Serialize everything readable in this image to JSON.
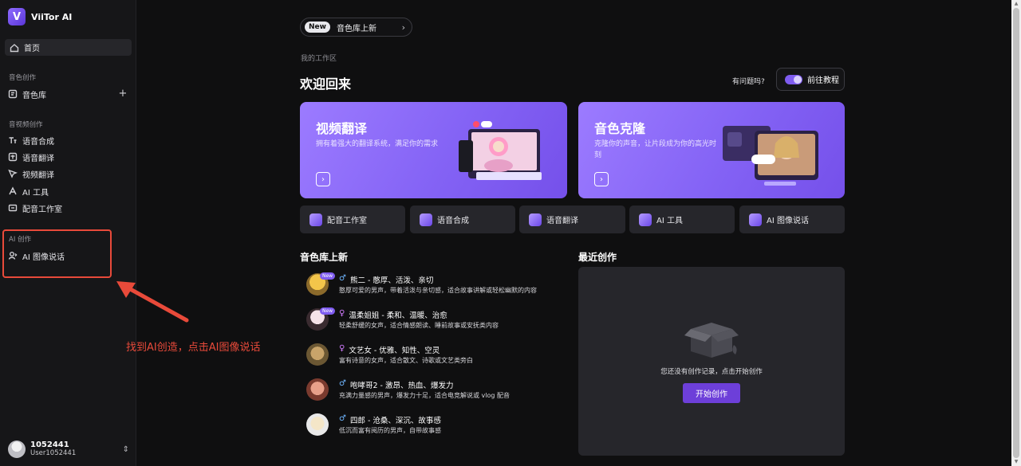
{
  "brand": {
    "logo_letter": "V",
    "name": "ViiTor AI"
  },
  "sidebar": {
    "home_label": "首页",
    "section_voice": "音色创作",
    "voice_library": "音色库",
    "section_av": "音视频创作",
    "av_items": [
      "语音合成",
      "语音翻译",
      "视频翻译",
      "AI 工具",
      "配音工作室"
    ],
    "section_ai": "AI 创作",
    "ai_image_talk": "AI 图像说话"
  },
  "user": {
    "name": "1052441",
    "handle": "User1052441"
  },
  "annotation": {
    "text": "找到AI创造，点击AI图像说话",
    "color": "#e84a3a"
  },
  "badge": {
    "tag": "New",
    "text": "音色库上新"
  },
  "main": {
    "workspace_label": "我的工作区",
    "welcome": "欢迎回来",
    "help_text": "有问题吗?",
    "tutorial_label": "前往教程"
  },
  "heroes": [
    {
      "title": "视频翻译",
      "desc": "拥有着强大的翻译系统，满足你的需求"
    },
    {
      "title": "音色克隆",
      "desc": "克隆你的声音，让片段成为你的高光时刻"
    }
  ],
  "quick_actions": [
    "配音工作室",
    "语音合成",
    "语音翻译",
    "AI 工具",
    "AI 图像说话"
  ],
  "voices_section_title": "音色库上新",
  "voices": [
    {
      "name": "熊二 - 憨厚、活泼、亲切",
      "gender": "♂",
      "desc": "憨厚可爱的男声，带着活泼与亲切感，适合故事讲解或轻松幽默的内容",
      "is_new": true,
      "new_label": "New"
    },
    {
      "name": "温柔姐姐 - 柔和、温暖、治愈",
      "gender": "♀",
      "desc": "轻柔舒缓的女声，适合情感朗读、睡前故事或安抚类内容",
      "is_new": true,
      "new_label": "New"
    },
    {
      "name": "文艺女 - 优雅、知性、空灵",
      "gender": "♀",
      "desc": "富有诗意的女声，适合散文、诗歌或文艺类旁白",
      "is_new": false
    },
    {
      "name": "咆哮哥2 - 激昂、热血、爆发力",
      "gender": "♂",
      "desc": "充满力量感的男声，爆发力十足，适合电竞解说或 vlog 配音",
      "is_new": false
    },
    {
      "name": "四郎 - 沧桑、深沉、故事感",
      "gender": "♂",
      "desc": "低沉而富有阅历的男声，自带故事感",
      "is_new": false
    }
  ],
  "recent": {
    "title": "最近创作",
    "empty_text": "您还没有创作记录，点击开始创作",
    "start_label": "开始创作"
  },
  "icons": {
    "home": "home-icon",
    "library": "library-icon",
    "tts": "tts-icon",
    "speech-translate": "speech-translate-icon",
    "video-translate": "video-translate-icon",
    "ai-tools": "ai-tools-icon",
    "studio": "studio-icon",
    "image-talk": "image-talk-icon"
  },
  "colors": {
    "accent": "#7f5cf0",
    "hero_start": "#9c7bff",
    "hero_end": "#7550ea",
    "male": "#6fb6ff",
    "female": "#d27bff",
    "annotation": "#e84a3a"
  }
}
